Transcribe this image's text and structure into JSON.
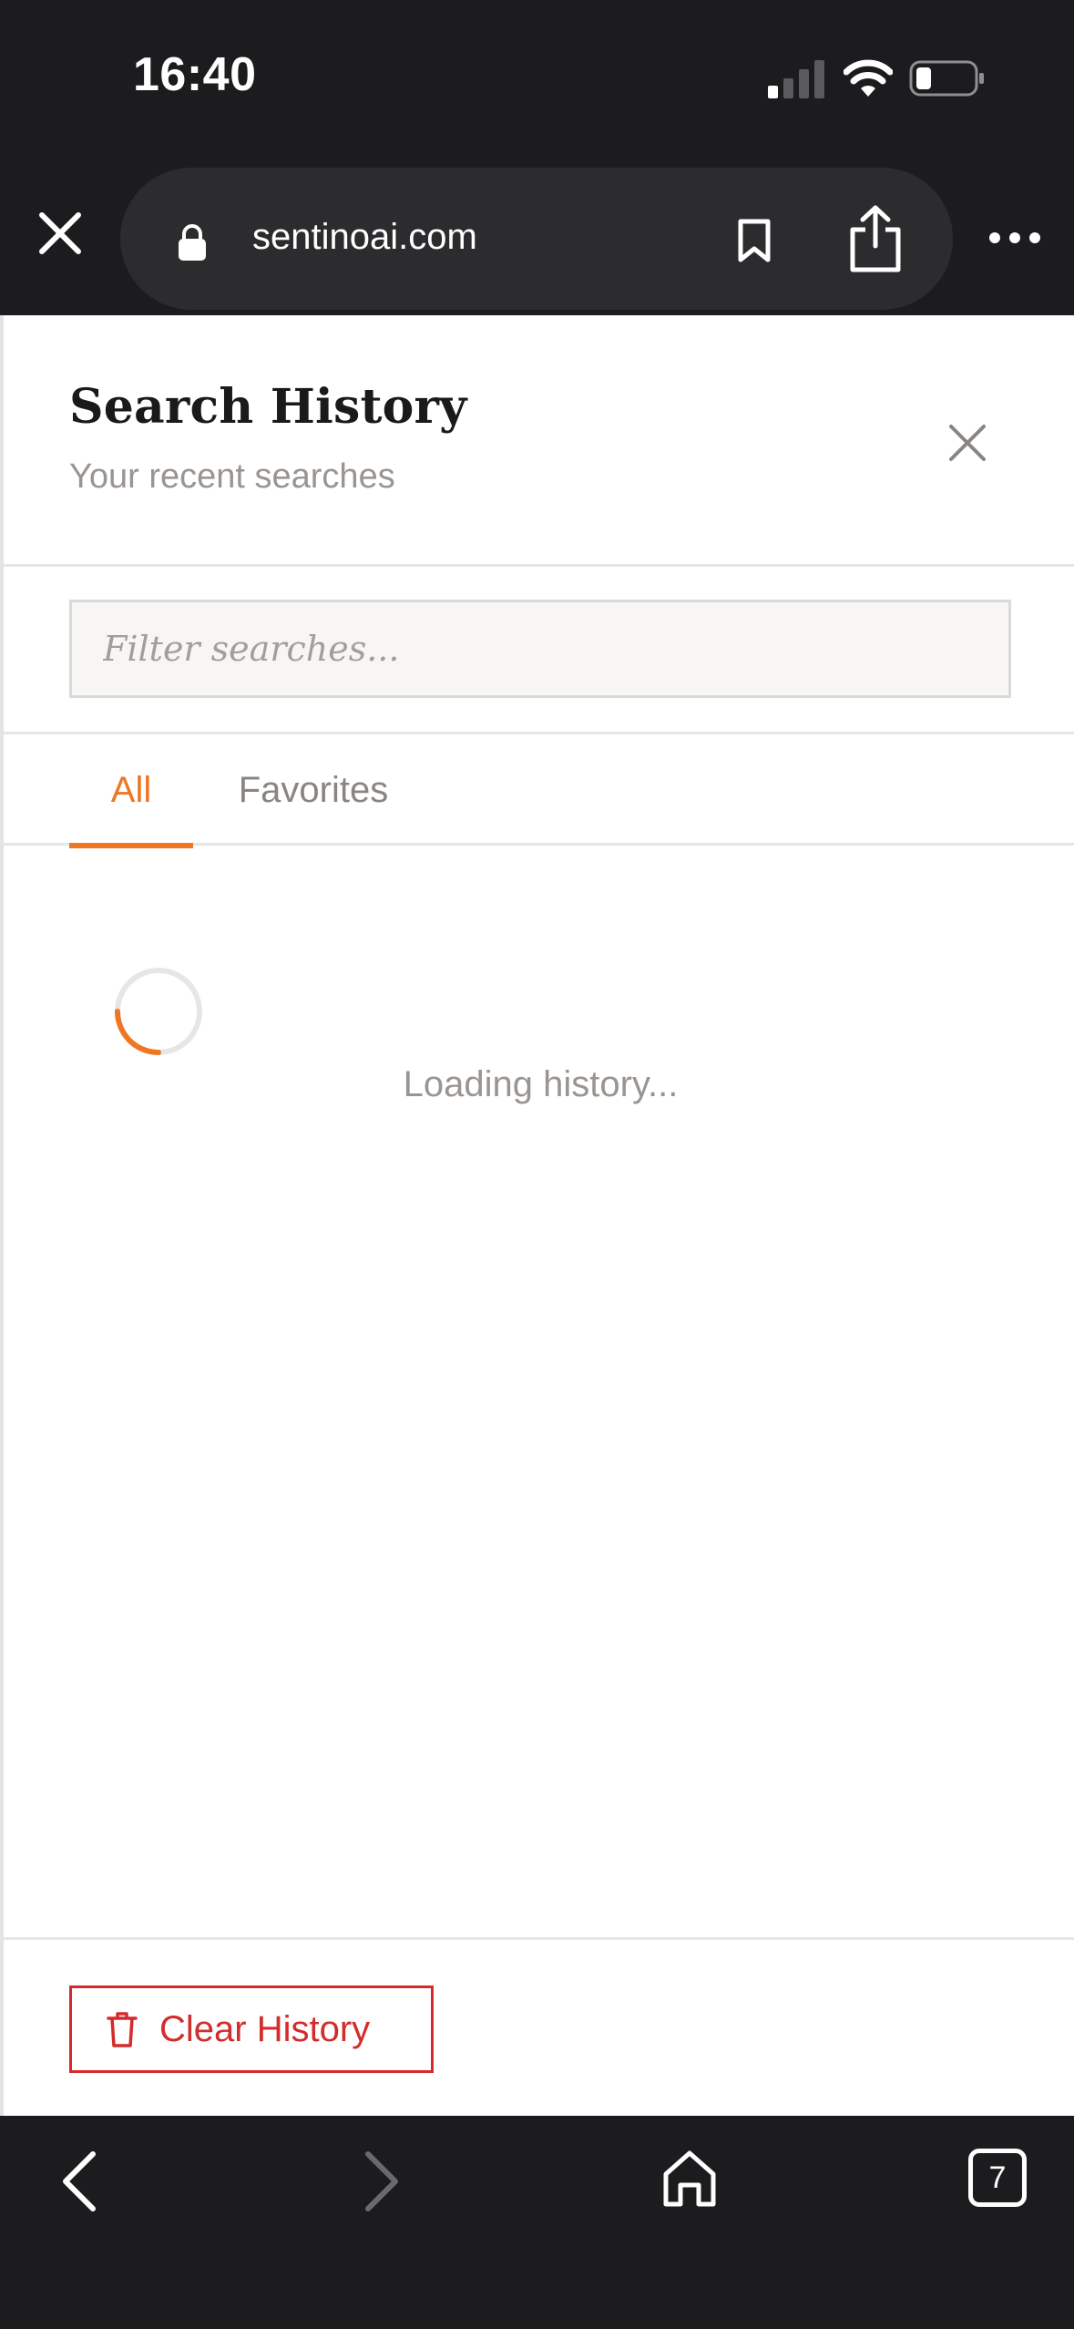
{
  "status_bar": {
    "time": "16:40"
  },
  "browser": {
    "url": "sentinoai.com"
  },
  "panel": {
    "title": "Search History",
    "subtitle": "Your recent searches",
    "filter_placeholder": "Filter searches...",
    "tabs": [
      {
        "label": "All",
        "active": true
      },
      {
        "label": "Favorites",
        "active": false
      }
    ],
    "loading_text": "Loading history...",
    "clear_button_label": "Clear History"
  },
  "bottom_nav": {
    "tab_count": "7"
  },
  "colors": {
    "accent": "#ee7722",
    "danger": "#d42c2c",
    "chrome": "#1c1c1e"
  },
  "icons": [
    "signal-icon",
    "wifi-icon",
    "battery-icon",
    "close-icon",
    "lock-icon",
    "bookmark-icon",
    "share-icon",
    "more-icon",
    "trash-icon",
    "back-icon",
    "forward-icon",
    "home-icon"
  ]
}
